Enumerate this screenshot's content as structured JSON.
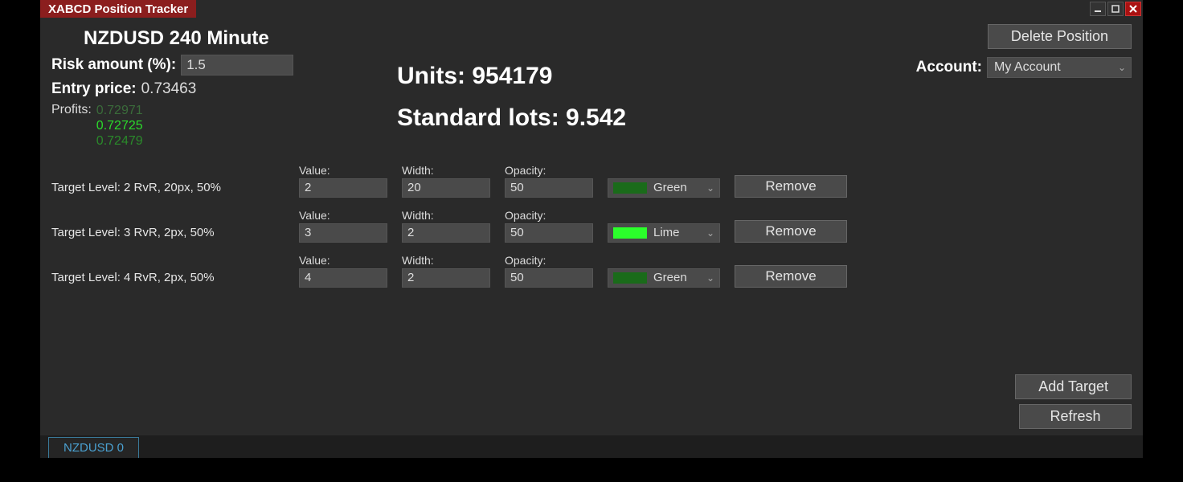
{
  "window": {
    "title": "XABCD Position Tracker"
  },
  "header": {
    "page_title": "NZDUSD 240 Minute",
    "risk_label": "Risk amount (%):",
    "risk_value": "1.5",
    "entry_label": "Entry price:",
    "entry_value": "0.73463",
    "profits_label": "Profits:",
    "profits": [
      "0.72971",
      "0.72725",
      "0.72479"
    ],
    "delete_label": "Delete Position",
    "account_label": "Account:",
    "account_value": "My Account"
  },
  "center": {
    "units_label": "Units:",
    "units_value": "954179",
    "lots_label": "Standard lots:",
    "lots_value": "9.542"
  },
  "targets_common": {
    "value_label": "Value:",
    "width_label": "Width:",
    "opacity_label": "Opacity:",
    "remove_label": "Remove"
  },
  "targets": [
    {
      "summary": "Target Level: 2 RvR,  20px,  50%",
      "value": "2",
      "width": "20",
      "opacity": "50",
      "color_name": "Green",
      "color_swatch": "swatch-green"
    },
    {
      "summary": "Target Level: 3 RvR,  2px,  50%",
      "value": "3",
      "width": "2",
      "opacity": "50",
      "color_name": "Lime",
      "color_swatch": "swatch-lime"
    },
    {
      "summary": "Target Level: 4 RvR,  2px,  50%",
      "value": "4",
      "width": "2",
      "opacity": "50",
      "color_name": "Green",
      "color_swatch": "swatch-green"
    }
  ],
  "actions": {
    "add_target": "Add Target",
    "refresh": "Refresh"
  },
  "tabs": [
    {
      "label": "NZDUSD 0"
    }
  ]
}
